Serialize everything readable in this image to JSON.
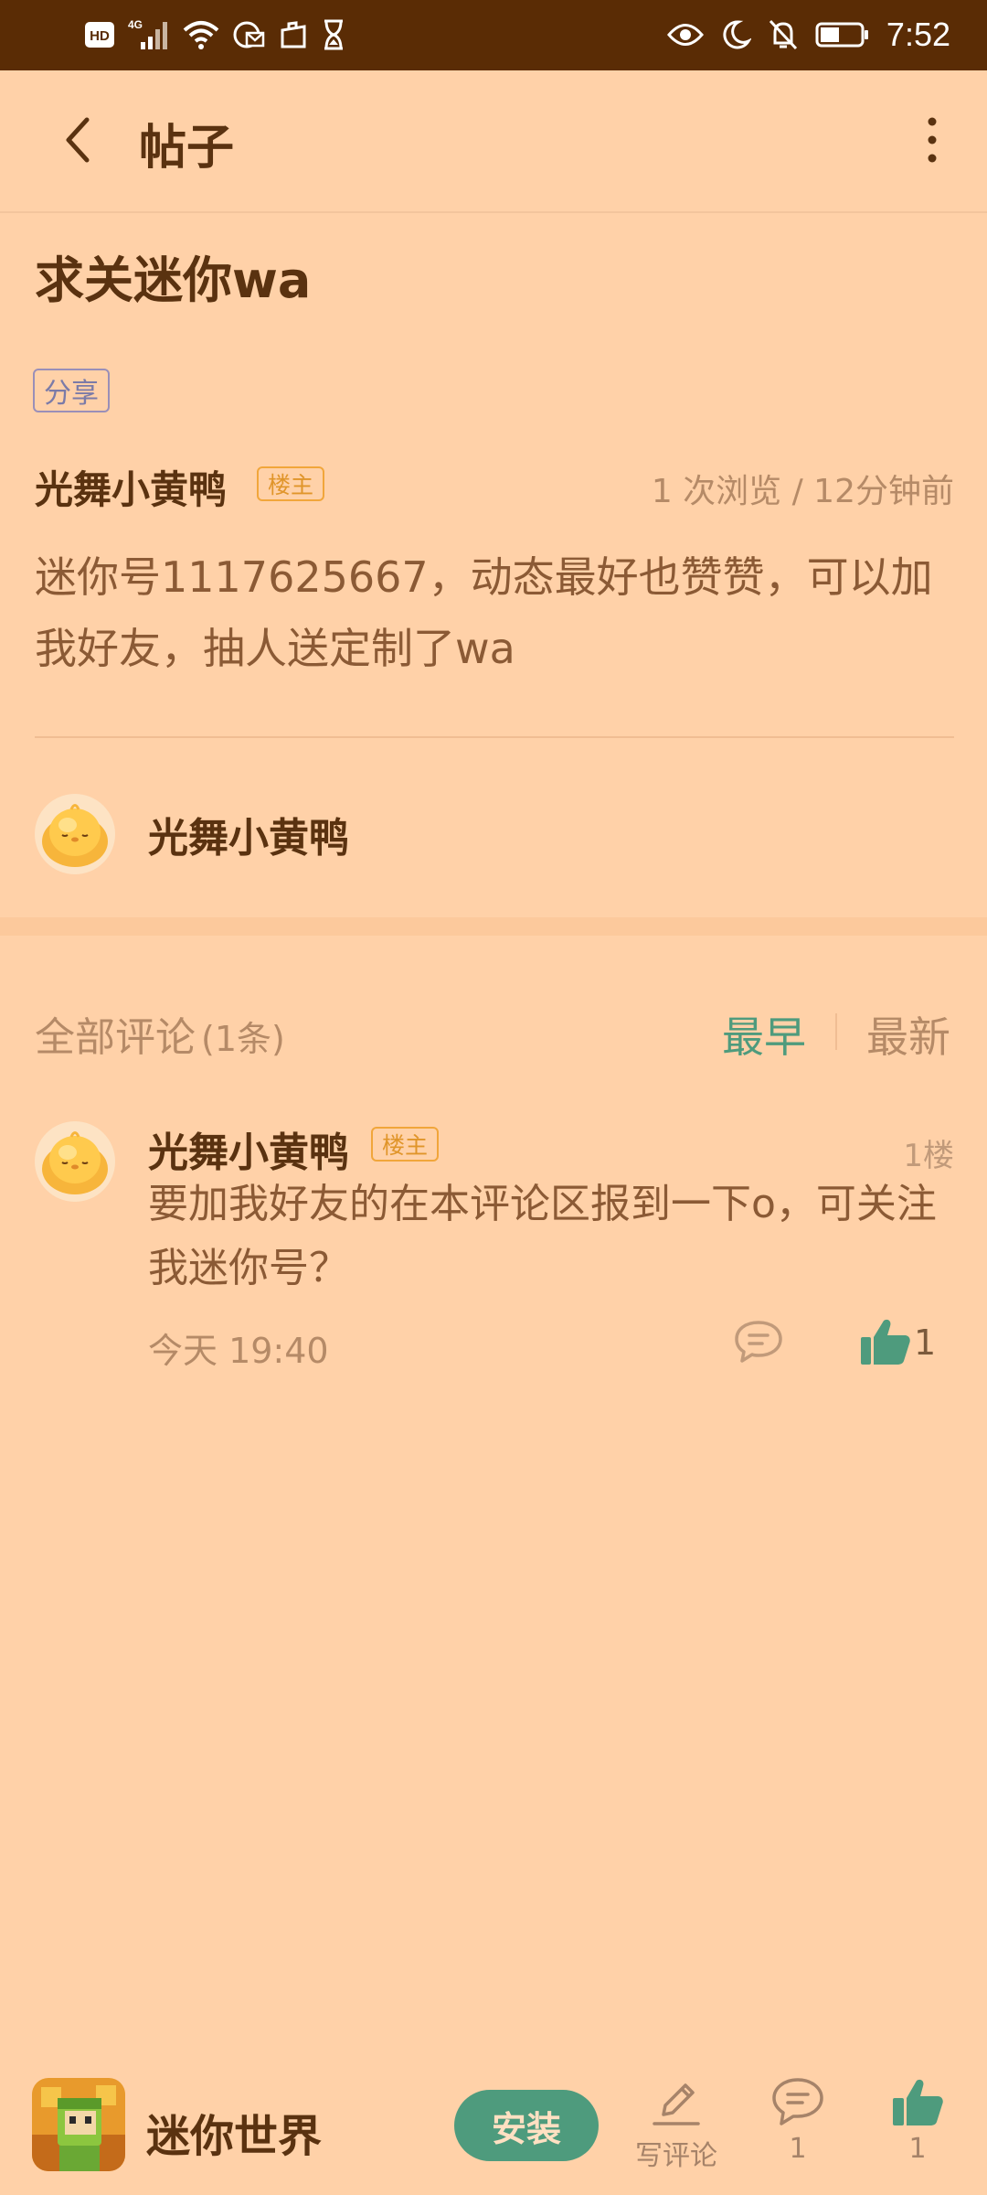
{
  "status_bar": {
    "time": "7:52",
    "network": "4G",
    "hd": "HD"
  },
  "header": {
    "title": "帖子"
  },
  "post": {
    "title": "求关迷你wa",
    "tag": "分享",
    "author": "光舞小黄鸭",
    "owner_badge": "楼主",
    "meta": "1 次浏览 / 12分钟前",
    "body": "迷你号1117625667，动态最好也赞赞，可以加我好友，抽人送定制了wa"
  },
  "author_card": {
    "name": "光舞小黄鸭"
  },
  "comments": {
    "heading": "全部评论",
    "count": "(1条)",
    "sort_earliest": "最早",
    "sort_latest": "最新",
    "items": [
      {
        "author": "光舞小黄鸭",
        "badge": "楼主",
        "floor": "1楼",
        "text": "要加我好友的在本评论区报到一下o，可关注我迷你号？",
        "time": "今天 19:40",
        "likes": "1"
      }
    ]
  },
  "bottom_bar": {
    "app_name": "迷你世界",
    "install": "安装",
    "write_comment": "写评论",
    "comment_count": "1",
    "like_count": "1"
  },
  "colors": {
    "background": "#ffd1a8",
    "status_bar": "#5a2c05",
    "accent_green": "#4e9b7d",
    "owner_badge": "#f1a63b",
    "text_dark": "#5a3210"
  }
}
